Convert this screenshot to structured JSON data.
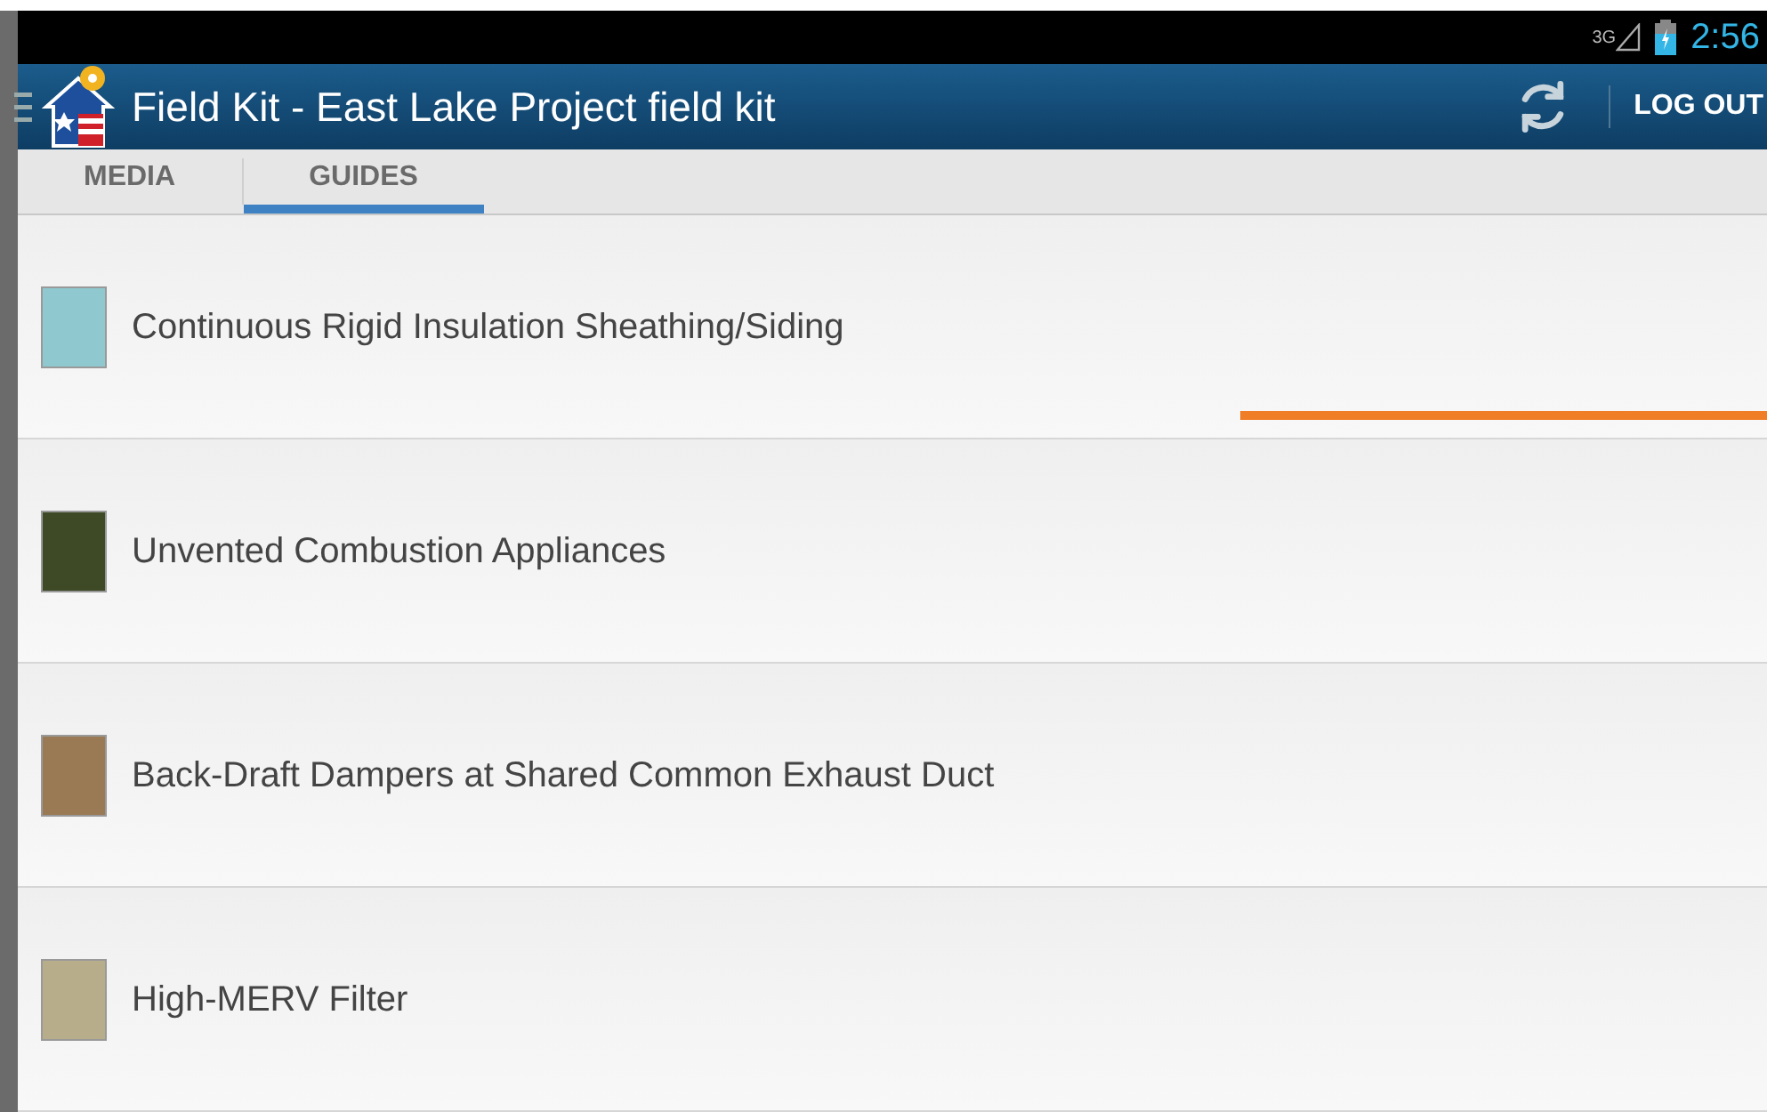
{
  "status_bar": {
    "network": "3G",
    "time": "2:56"
  },
  "app_bar": {
    "title": "Field Kit - East Lake Project field kit",
    "action": "LOG OUT"
  },
  "tabs": [
    {
      "label": "MEDIA",
      "selected": false
    },
    {
      "label": "GUIDES",
      "selected": true
    }
  ],
  "guides": [
    {
      "title": "Continuous Rigid Insulation Sheathing/Siding"
    },
    {
      "title": "Unvented Combustion Appliances"
    },
    {
      "title": "Back-Draft Dampers at Shared Common Exhaust Duct"
    },
    {
      "title": "High-MERV Filter"
    }
  ]
}
